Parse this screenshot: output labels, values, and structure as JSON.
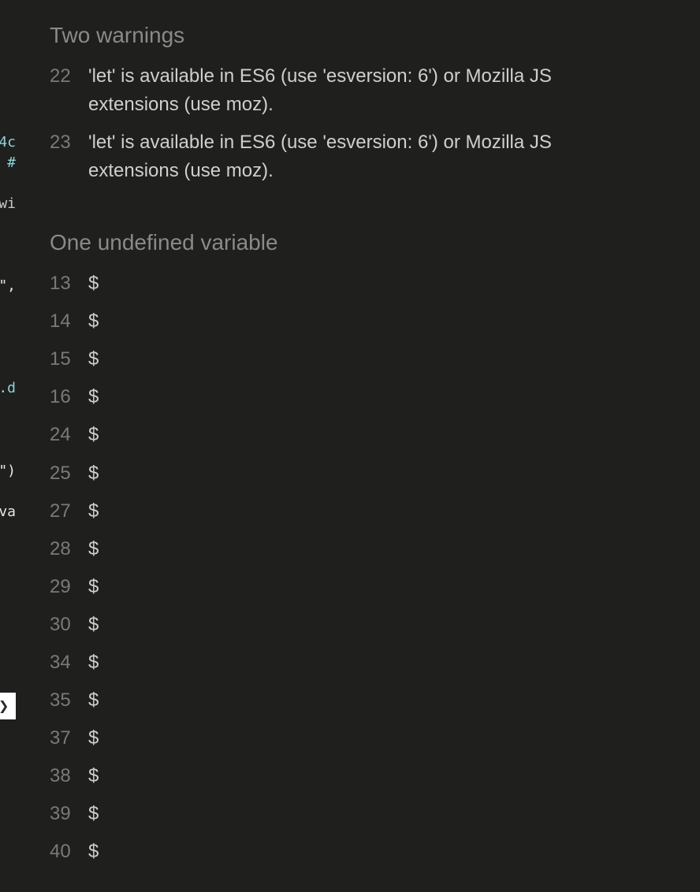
{
  "code_fragments": [
    {
      "text": "4c",
      "tone": "teal"
    },
    {
      "text": "#",
      "tone": "teal"
    },
    {
      "text": "wi",
      "tone": "gray"
    },
    {
      "text": "\",",
      "tone": "white"
    },
    {
      "text": ".d",
      "tone": "teal"
    },
    {
      "text": "\")",
      "tone": "white"
    },
    {
      "text": "va",
      "tone": "white"
    }
  ],
  "warnings": {
    "title": "Two warnings",
    "items": [
      {
        "line": "22",
        "message": "'let' is available in ES6 (use 'esversion: 6') or Mozilla JS extensions (use moz)."
      },
      {
        "line": "23",
        "message": "'let' is available in ES6 (use 'esversion: 6') or Mozilla JS extensions (use moz)."
      }
    ]
  },
  "undefined_variables": {
    "title": "One undefined variable",
    "items": [
      {
        "line": "13",
        "name": "$"
      },
      {
        "line": "14",
        "name": "$"
      },
      {
        "line": "15",
        "name": "$"
      },
      {
        "line": "16",
        "name": "$"
      },
      {
        "line": "24",
        "name": "$"
      },
      {
        "line": "25",
        "name": "$"
      },
      {
        "line": "27",
        "name": "$"
      },
      {
        "line": "28",
        "name": "$"
      },
      {
        "line": "29",
        "name": "$"
      },
      {
        "line": "30",
        "name": "$"
      },
      {
        "line": "34",
        "name": "$"
      },
      {
        "line": "35",
        "name": "$"
      },
      {
        "line": "37",
        "name": "$"
      },
      {
        "line": "38",
        "name": "$"
      },
      {
        "line": "39",
        "name": "$"
      },
      {
        "line": "40",
        "name": "$"
      }
    ]
  },
  "expand_arrow_icon": "chevron-right-icon"
}
